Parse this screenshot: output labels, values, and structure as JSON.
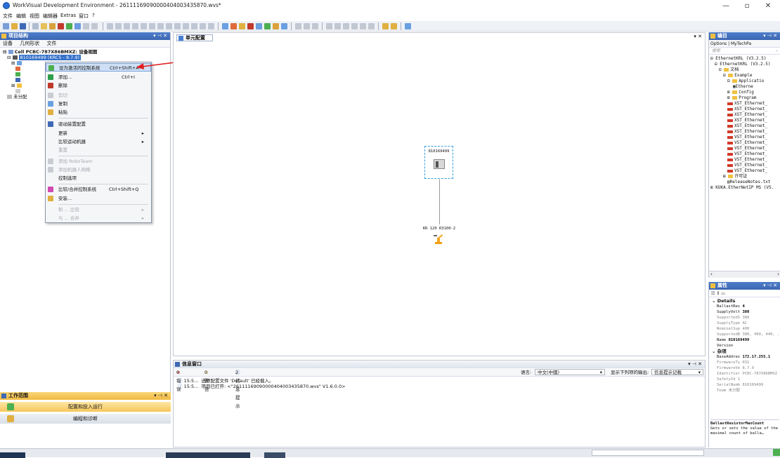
{
  "window": {
    "title": "WorkVisual Development Environment - 26111169090000404003435870.wvs*",
    "minimize": "—",
    "maximize": "▫",
    "close": "✕"
  },
  "menu": [
    "文件",
    "编辑",
    "视图",
    "编辑器",
    "Extras",
    "窗口",
    "?"
  ],
  "project_panel": {
    "title": "项目结构",
    "tabs": [
      "设备",
      "几何形状",
      "文件"
    ],
    "cell": "Cell PCBC-787X86BMXZ: 设备视图",
    "selected_node": "810169499 (KRC5 - 8.7.9)",
    "unassigned": "未分配"
  },
  "context_menu": {
    "items": [
      {
        "label": "设为激活的控制系统",
        "shortcut": "Ctrl+Shift+A",
        "disabled": false
      },
      {
        "label": "添加...",
        "shortcut": "Ctrl+I",
        "disabled": false
      },
      {
        "label": "删除",
        "shortcut": "",
        "disabled": false
      },
      {
        "label": "剪切",
        "shortcut": "",
        "disabled": true
      },
      {
        "label": "复制",
        "shortcut": "",
        "disabled": false
      },
      {
        "label": "粘贴",
        "shortcut": "",
        "disabled": false
      },
      {
        "label": "驱动装置配置",
        "shortcut": "",
        "disabled": false
      },
      {
        "label": "更新",
        "shortcut": "",
        "disabled": false,
        "submenu": true
      },
      {
        "label": "比较运动机器",
        "shortcut": "",
        "disabled": false,
        "submenu": true
      },
      {
        "label": "重置",
        "shortcut": "",
        "disabled": true
      },
      {
        "label": "添加 RoboTeam",
        "shortcut": "",
        "disabled": true
      },
      {
        "label": "添加机器人网络",
        "shortcut": "",
        "disabled": true
      },
      {
        "label": "控制选项",
        "shortcut": "",
        "disabled": false
      },
      {
        "label": "比较/合并控制系统",
        "shortcut": "Ctrl+Shift+Q",
        "disabled": false
      },
      {
        "label": "安装...",
        "shortcut": "",
        "disabled": false
      },
      {
        "label": "和 ... 比较",
        "shortcut": "",
        "disabled": true,
        "submenu": true
      },
      {
        "label": "与 ... 合并",
        "shortcut": "",
        "disabled": true,
        "submenu": true
      }
    ]
  },
  "editor": {
    "tab": "单元配置",
    "controller_label": "810169499",
    "robot_label": "KR 120 R3100-2"
  },
  "info_window": {
    "title": "信息窗口",
    "errors": "0 错误",
    "warnings": "0 警告",
    "infos": "2 信息提示",
    "language_label": "语言:",
    "language_value": "中文(中國)",
    "show_label": "显示下列项的输出:",
    "show_value": "信息提示记载",
    "messages": [
      {
        "time": "15:5...",
        "text": "选项配置文件 'Default' 已经载入。"
      },
      {
        "time": "15:5...",
        "text": "项目已打开: <\"26111169090000404003435870.wvs\" V1.6.0.0>"
      }
    ]
  },
  "workspace": {
    "title": "工作范围",
    "items": [
      "配置和投入运行",
      "编程和诊断"
    ]
  },
  "catalog": {
    "title": "编目",
    "tabs": [
      "Options",
      "MyTechPa"
    ],
    "search_placeholder": "搜索",
    "tree": [
      "EthernetKRL (V3.2.5)",
      "EthernetKRL (V3.2.5)",
      "文档",
      "Example",
      "Applicatio",
      "Etherne",
      "Config",
      "Program",
      "XST_Ethernet_",
      "XST_Ethernet_",
      "XST_Ethernet_",
      "XST_Ethernet_",
      "XST_Ethernet_",
      "XST_Ethernet_",
      "VST_Ethernet_",
      "VST_Ethernet_",
      "VST_Ethernet_",
      "VST_Ethernet_",
      "VST_Ethernet_",
      "VST_Ethernet_",
      "VST_Ethernet_",
      "许可证",
      "ReleaseNotes.txt",
      "KUKA.EtherNetIP MS (V5."
    ]
  },
  "properties": {
    "title": "属性",
    "details_group": "Details",
    "misc_group": "杂项",
    "rows": [
      {
        "k": "BallastRes",
        "v": "4",
        "bold": true
      },
      {
        "k": "SupplyVolt",
        "v": "380",
        "bold": true
      },
      {
        "k": "SupportedS",
        "v": "380",
        "bold": false
      },
      {
        "k": "SupplyType",
        "v": "AC",
        "bold": false
      },
      {
        "k": "NominalSup",
        "v": "400",
        "bold": false
      },
      {
        "k": "SupportedB",
        "v": "380, 400, 440, .",
        "bold": false
      },
      {
        "k": "Name",
        "v": "810169499",
        "bold": true
      },
      {
        "k": "Version",
        "v": "",
        "bold": false
      }
    ],
    "misc_rows": [
      {
        "k": "BaseAddres",
        "v": "172.17.255.1",
        "bold": true
      },
      {
        "k": "FirmwareTy",
        "v": "KSS",
        "bold": false
      },
      {
        "k": "FirmwareVe",
        "v": "8.7.9",
        "bold": false
      },
      {
        "k": "Identifier",
        "v": "PCBC-787X86BMXZ",
        "bold": false
      },
      {
        "k": "SafetyId",
        "v": "1",
        "bold": false
      },
      {
        "k": "SerialNumb",
        "v": "810169499",
        "bold": false
      },
      {
        "k": "Team",
        "v": "未分配",
        "bold": false
      }
    ],
    "desc_title": "BallastResistorMaxCount",
    "desc_text": "Gets or sets the value of the maximal count of balla…"
  }
}
